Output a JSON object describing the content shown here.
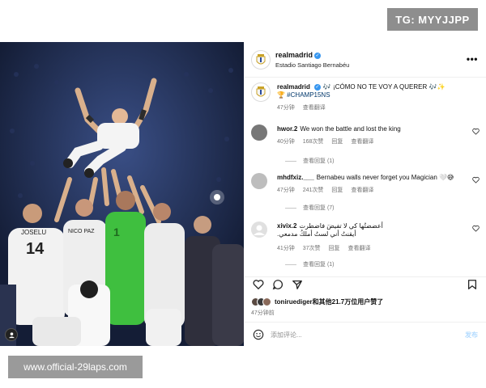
{
  "watermarks": {
    "top": "TG: MYYJJPP",
    "bottom": "www.official-29laps.com"
  },
  "post": {
    "username": "realmadrid",
    "location": "Estadio Santiago Bernabéu",
    "more_icon": "more-horizontal-icon",
    "caption": {
      "username": "realmadrid",
      "text": "🎶 ¡CÓMO NO TE VOY A QUERER 🎶✨",
      "line2": "🏆 #CHAMP15NS",
      "time": "47分钟",
      "translate": "查看翻译"
    },
    "comments": [
      {
        "username": "hwor.2",
        "text": "We won the battle and lost the king",
        "time": "40分钟",
        "likes": "168次赞",
        "reply": "回复",
        "translate": "查看翻译",
        "replies": "查看回复 (1)",
        "avatar_color": "#777777"
      },
      {
        "username": "mhdfxiz.___",
        "text": "Bernabeu walls never forget you Magician 🤍😅",
        "time": "47分钟",
        "likes": "241次赞",
        "reply": "回复",
        "translate": "查看翻译",
        "replies": "查看回复 (7)",
        "avatar_color": "#b9b9b9"
      },
      {
        "username": "xivix.2",
        "text": "أعضضتُها كي لا تفيضَ فاضطرت",
        "text2": "أيقنتُ أني لستُ أملكُ مدمعي.",
        "time": "41分钟",
        "likes": "37次赞",
        "reply": "回复",
        "translate": "查看翻译",
        "replies": "查看回复 (1)",
        "avatar_color": "#d6d6d6"
      }
    ],
    "likes_line": "toniruediger和其他21.7万位用户赞了",
    "likes_time": "47分钟前",
    "add_comment": "添加评论...",
    "post_button": "发布"
  },
  "colors": {
    "verified": "#3897f0",
    "photo_bg": "#1e2a4a",
    "kit_white": "#ffffff",
    "goalkeeper_green": "#3fbf3f"
  }
}
